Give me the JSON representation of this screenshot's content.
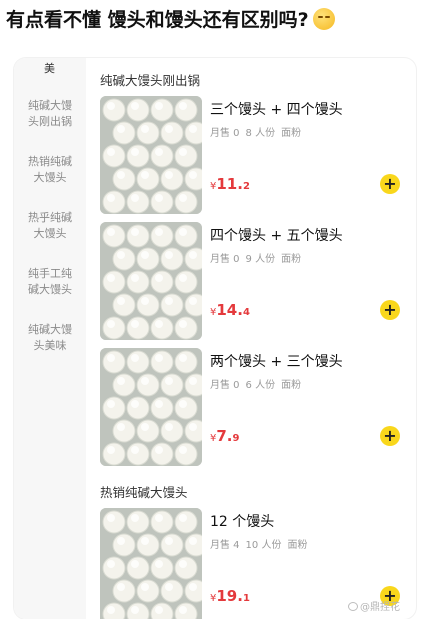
{
  "post": {
    "headline": "有点看不懂 馒头和馒头还有区别吗?"
  },
  "sidebar": {
    "top_fragment": "美",
    "items": [
      {
        "line1": "纯碱大馒",
        "line2": "头刚出锅"
      },
      {
        "line1": "热销纯碱",
        "line2": "大馒头"
      },
      {
        "line1": "热乎纯碱",
        "line2": "大馒头"
      },
      {
        "line1": "纯手工纯",
        "line2": "碱大馒头"
      },
      {
        "line1": "纯碱大馒",
        "line2": "头美味"
      }
    ]
  },
  "sections": [
    {
      "title": "纯碱大馒头刚出锅"
    },
    {
      "title": "热销纯碱大馒头"
    }
  ],
  "products": [
    {
      "name": "三个馒头 + 四个馒头",
      "sales": "月售 0",
      "serving": "8 人份",
      "material": "面粉",
      "currency": "¥",
      "price_int": "11.",
      "price_dec": "2"
    },
    {
      "name": "四个馒头 + 五个馒头",
      "sales": "月售 0",
      "serving": "9 人份",
      "material": "面粉",
      "currency": "¥",
      "price_int": "14.",
      "price_dec": "4"
    },
    {
      "name": "两个馒头 + 三个馒头",
      "sales": "月售 0",
      "serving": "6 人份",
      "material": "面粉",
      "currency": "¥",
      "price_int": "7.",
      "price_dec": "9"
    },
    {
      "name": "12 个馒头",
      "sales": "月售 4",
      "serving": "10 人份",
      "material": "面粉",
      "currency": "¥",
      "price_int": "19.",
      "price_dec": "1"
    }
  ],
  "add_button_glyph": "+",
  "watermark": "@鼎捏花",
  "colors": {
    "price": "#e4393c",
    "add_button": "#f9d71c",
    "sidebar_bg": "#f7f7f7"
  }
}
